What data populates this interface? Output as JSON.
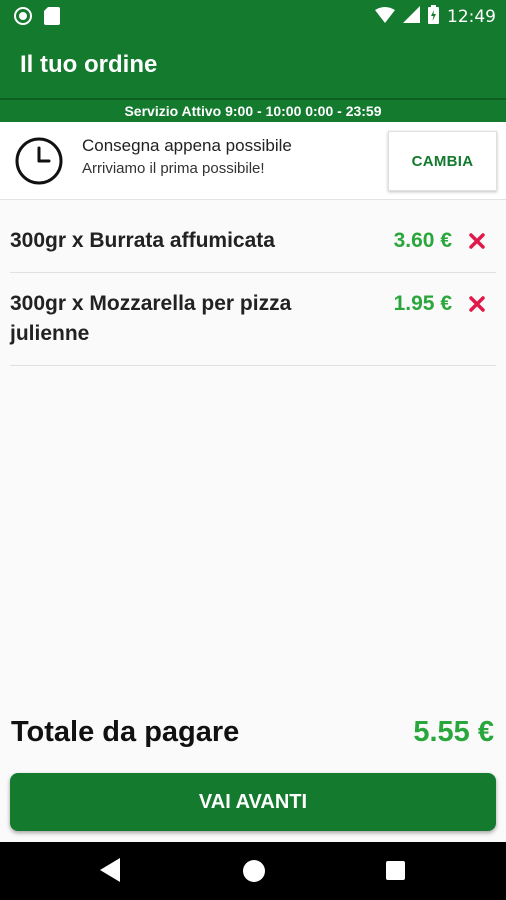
{
  "status_bar": {
    "time": "12:49",
    "icons": [
      "circle-notification-icon",
      "sd-card-icon",
      "wifi-icon",
      "signal-icon",
      "battery-charging-icon"
    ]
  },
  "app_bar": {
    "title": "Il tuo ordine"
  },
  "service": {
    "text": "Servizio Attivo  9:00 - 10:00  0:00 - 23:59"
  },
  "delivery": {
    "icon": "clock-icon",
    "title": "Consegna appena possibile",
    "subtitle": "Arriviamo il prima possibile!",
    "change_label": "CAMBIA"
  },
  "items": [
    {
      "name": "300gr x Burrata affumicata",
      "price": "3.60 €"
    },
    {
      "name": "300gr x Mozzarella per pizza julienne",
      "price": "1.95 €"
    }
  ],
  "total": {
    "label": "Totale da pagare",
    "value": "5.55 €"
  },
  "next_button": {
    "label": "VAI AVANTI"
  },
  "colors": {
    "primary": "#137a2e",
    "price": "#2aa73c",
    "remove": "#e0194a"
  },
  "nav": {
    "icons": [
      "back-icon",
      "home-icon",
      "recents-icon"
    ]
  }
}
